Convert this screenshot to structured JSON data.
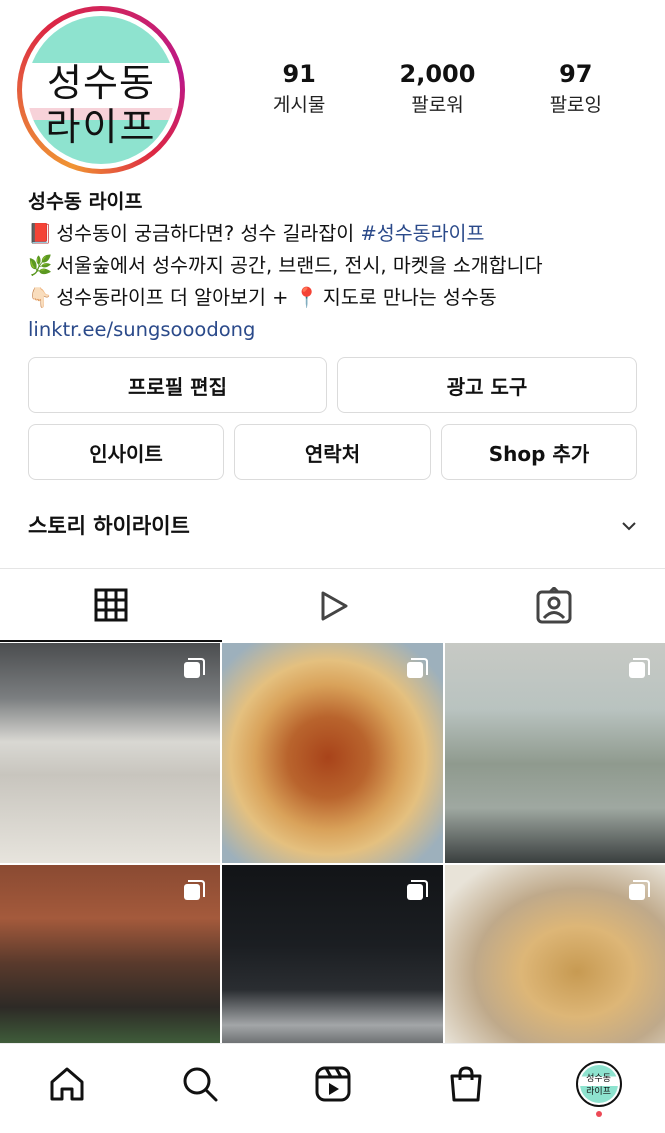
{
  "profile": {
    "logo_line1": "성수동",
    "logo_line2": "라이프",
    "name": "성수동 라이프",
    "bio_line1_text": "성수동이 궁금하다면? 성수 길라잡이 ",
    "bio_line1_hashtag": "#성수동라이프",
    "bio_line2": "서울숲에서 성수까지 공간, 브랜드, 전시, 마켓을 소개합니다",
    "bio_line3_a": "성수동라이프 더 알아보기 + ",
    "bio_line3_b": " 지도로 만나는 성수동",
    "link": "linktr.ee/sungsooodong",
    "emoji_book": "📕",
    "emoji_leaf": "🌿",
    "emoji_hand": "👇🏻",
    "emoji_pin": "📍"
  },
  "stats": [
    {
      "value": "91",
      "label": "게시물"
    },
    {
      "value": "2,000",
      "label": "팔로워"
    },
    {
      "value": "97",
      "label": "팔로잉"
    }
  ],
  "buttons": {
    "edit_profile": "프로필 편집",
    "ad_tools": "광고 도구",
    "insights": "인사이트",
    "contact": "연락처",
    "add_shop": "Shop 추가"
  },
  "highlights": {
    "title": "스토리 하이라이트"
  },
  "tabs": [
    {
      "name": "grid-icon",
      "active": true
    },
    {
      "name": "reels-icon",
      "active": false
    },
    {
      "name": "tagged-icon",
      "active": false
    }
  ],
  "mini_avatar": {
    "line1": "성수동",
    "line2": "라이프"
  },
  "colors": {
    "link": "#2b4a8a",
    "mint": "#8ee3cf",
    "notification_dot": "#ed4956"
  }
}
